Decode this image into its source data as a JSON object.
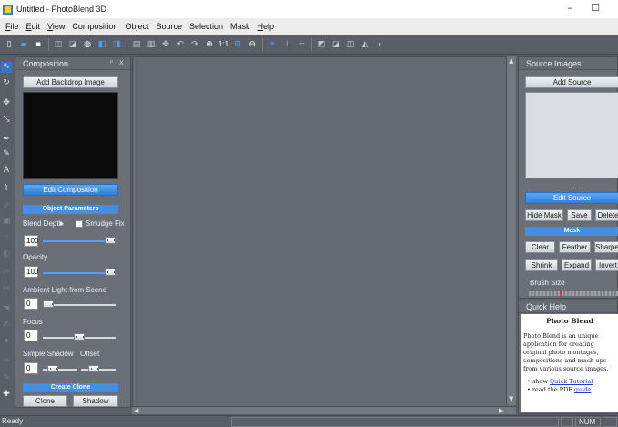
{
  "window": {
    "title": "Untitled - PhotoBlend 3D",
    "minimize_glyph": "–",
    "maximize_glyph": "☐"
  },
  "menu": [
    {
      "label": "File",
      "u": "F",
      "rest": "ile"
    },
    {
      "label": "Edit",
      "u": "E",
      "rest": "dit"
    },
    {
      "label": "View",
      "u": "V",
      "rest": "iew"
    },
    {
      "label": "Composition",
      "u": "",
      "rest": "Composition"
    },
    {
      "label": "Object",
      "u": "",
      "rest": "Object"
    },
    {
      "label": "Source",
      "u": "",
      "rest": "Source"
    },
    {
      "label": "Selection",
      "u": "",
      "rest": "Selection"
    },
    {
      "label": "Mask",
      "u": "",
      "rest": "Mask"
    },
    {
      "label": "Help",
      "u": "H",
      "rest": "elp"
    }
  ],
  "toolbar": {
    "zoom_actual_label": "1:1"
  },
  "composition": {
    "title": "Composition",
    "pin_glyph": "ᵖ",
    "close_glyph": "x",
    "add_backdrop": "Add Backdrop Image",
    "edit_composition": "Edit Composition",
    "object_parameters": "Object Parameters",
    "blend_depth_label": "Blend Depth",
    "blend_depth_arrow": "▸",
    "smudge_fix_label": "Smudge Fix",
    "blend_depth_value": "100",
    "opacity_label": "Opacity",
    "opacity_value": "100",
    "ambient_label": "Ambient Light from Scene",
    "ambient_value": "0",
    "focus_label": "Focus",
    "focus_value": "0",
    "simple_shadow_label": "Simple Shadow",
    "offset_label": "Offset",
    "shadow_value": "0",
    "create_clone": "Create Clone",
    "clone_button": "Clone",
    "shadow_button": "Shadow",
    "sliders": {
      "blend_depth_level": 1.0,
      "opacity_level": 1.0,
      "ambient_level": 0.0,
      "focus_level": 0.5,
      "shadow_level": 0.2,
      "offset_level": 0.3
    }
  },
  "source": {
    "title": "Source Images",
    "add_source": "Add Source",
    "edit_source": "Edit Source",
    "hide_mask": "Hide Mask",
    "save": "Save",
    "delete": "Delete",
    "mask": "Mask",
    "clear": "Clear",
    "feather": "Feather",
    "sharpen": "Sharpen",
    "shrink": "Shrink",
    "expand": "Expand",
    "invert": "Invert",
    "brush_size": "Brush Size",
    "dots": "....",
    "brush_size_level": 0.35
  },
  "quick_help": {
    "title": "Quick Help",
    "heading": "Photo Blend",
    "body": "Photo Blend is an unique application for creating original photo montages, compositions and mash-ups from various source images.",
    "item1_prefix": "show ",
    "item1_link": "Quick Tutorial",
    "item2_prefix": "read the PDF ",
    "item2_link": "guide"
  },
  "status": {
    "text": "Ready",
    "num": "NUM"
  },
  "colors": {
    "accent_blue": "#3f8fe8",
    "panel_bg": "#6a6e76",
    "canvas_bg": "#666a72"
  }
}
